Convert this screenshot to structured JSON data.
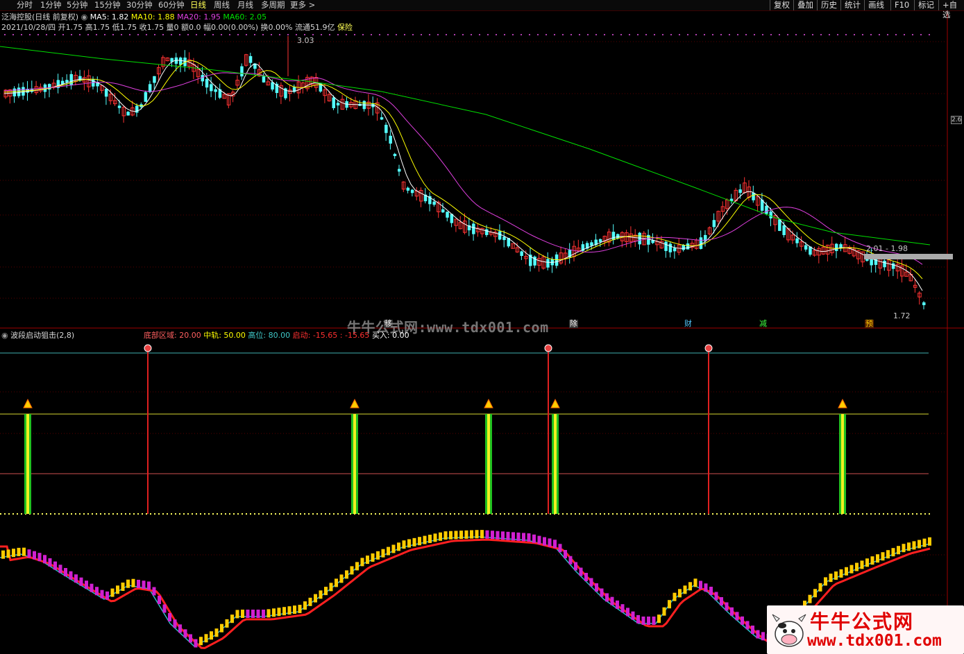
{
  "toolbar": {
    "periods": [
      "分时",
      "1分钟",
      "5分钟",
      "15分钟",
      "30分钟",
      "60分钟",
      "日线",
      "周线",
      "月线",
      "多周期",
      "更多 >"
    ],
    "active_period": "日线",
    "right_buttons": [
      "复权",
      "叠加",
      "历史",
      "统计",
      "画线",
      "F10",
      "标记",
      "+自选"
    ]
  },
  "info": {
    "stock": "泛海控股(日线 前复权)",
    "ma5": "MA5: 1.82",
    "ma10": "MA10: 1.88",
    "ma20": "MA20: 1.95",
    "ma60": "MA60: 2.05",
    "bar_detail": "2021/10/28/四 开1.75 高1.75 低1.75 收1.75 量0 额0.0 幅0.00(0.00%) 换0.00% 流通51.9亿",
    "tag": "保险"
  },
  "price_labels": {
    "high": "3.03",
    "low": "1.72",
    "range": "2.01 - 1.98"
  },
  "right_axis_box": "2.6",
  "event_markers": [
    "移",
    "除",
    "财",
    "减",
    "预"
  ],
  "indicator": {
    "name": "波段启动狙击(2,8)",
    "items": [
      {
        "label": "底部区域: ",
        "value": "20.00"
      },
      {
        "label": "中轨: ",
        "value": "50.00"
      },
      {
        "label": "高位: ",
        "value": "80.00"
      },
      {
        "label": "启动: ",
        "value": "-15.65 : -15.65"
      },
      {
        "label": "买入: ",
        "value": "0.00"
      }
    ]
  },
  "watermark": "牛牛公式网:www.tdx001.com",
  "logo": {
    "title": "牛牛公式网",
    "url": "www.tdx001.com"
  },
  "colors": {
    "ma5": "#ffffff",
    "ma10": "#ffff00",
    "ma20": "#e040e0",
    "ma60": "#00e000",
    "up": "#ff3333",
    "down": "#54ffff",
    "border": "#a00000"
  }
}
